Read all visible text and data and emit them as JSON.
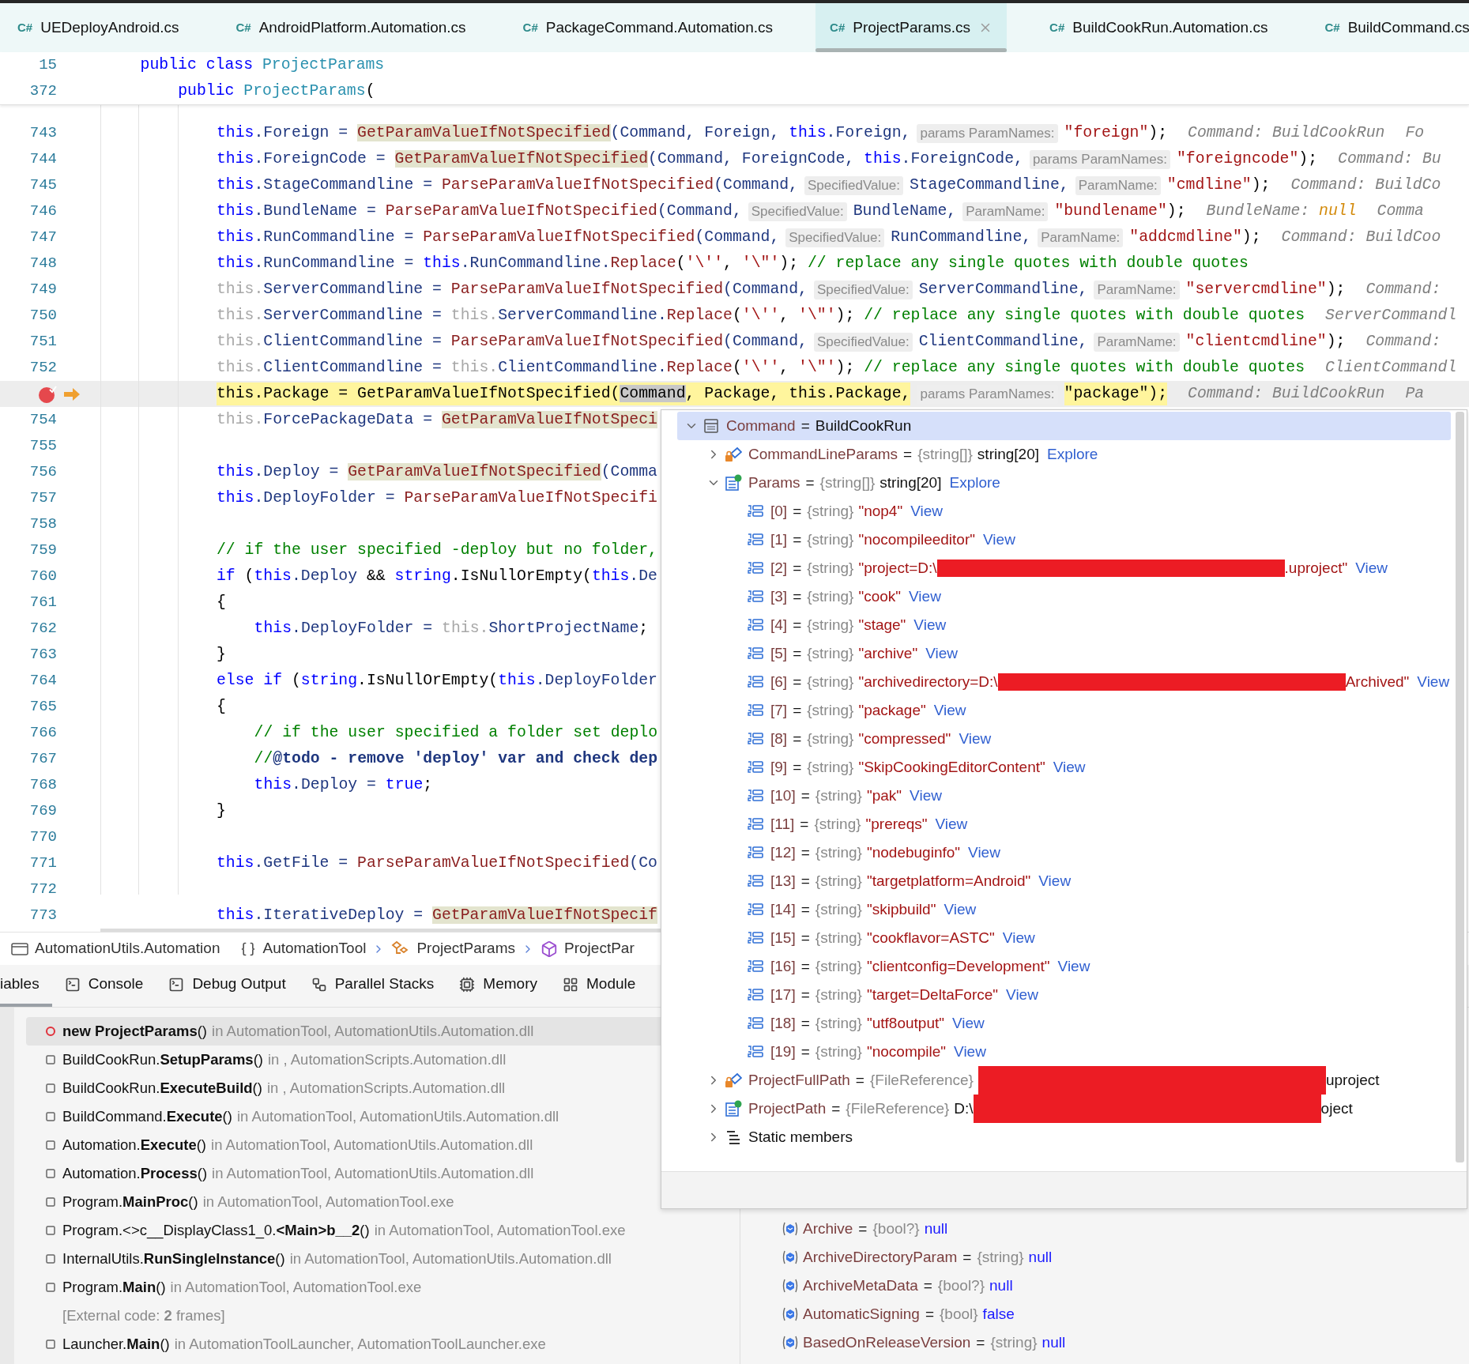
{
  "editor_tabs": [
    {
      "lang": "C#",
      "label": "UEDeployAndroid.cs",
      "selected": false
    },
    {
      "lang": "C#",
      "label": "AndroidPlatform.Automation.cs",
      "selected": false
    },
    {
      "lang": "C#",
      "label": "PackageCommand.Automation.cs",
      "selected": false
    },
    {
      "lang": "C#",
      "label": "ProjectParams.cs",
      "selected": true
    },
    {
      "lang": "C#",
      "label": "BuildCookRun.Automation.cs",
      "selected": false
    },
    {
      "lang": "C#",
      "label": "BuildCommand.cs",
      "selected": false
    }
  ],
  "sticky_header": [
    {
      "number": "15",
      "segments": [
        {
          "kind": "code",
          "tokens": [
            {
              "kind": "kw",
              "text": "public class "
            },
            {
              "kind": "type",
              "text": "ProjectParams"
            }
          ]
        }
      ],
      "children": [
        {
          "number": "372",
          "segments": [
            {
              "kind": "code",
              "tokens": [
                {
                  "kind": "kw",
                  "text": "public "
                },
                {
                  "kind": "type",
                  "text": "ProjectParams"
                },
                {
                  "kind": "p",
                  "text": "("
                }
              ]
            }
          ]
        }
      ]
    }
  ],
  "code": {
    "lines": [
      {
        "number": "743",
        "breakpoint": false,
        "current": false,
        "segments": [
          {
            "kind": "code",
            "tokens": [
              {
                "kind": "kw",
                "text": "this"
              },
              {
                "kind": "id",
                "text": ".Foreign = "
              },
              {
                "kind": "fnhl",
                "text": "GetParamValueIfNotSpecified"
              },
              {
                "kind": "id",
                "text": "(Command, Foreign, "
              },
              {
                "kind": "kw",
                "text": "this"
              },
              {
                "kind": "id",
                "text": ".Foreign,"
              }
            ]
          },
          {
            "kind": "hint",
            "text": "params ParamNames:"
          },
          {
            "kind": "code",
            "tokens": [
              {
                "kind": "str",
                "text": "\"foreign\""
              },
              {
                "kind": "p",
                "text": ");"
              }
            ]
          },
          {
            "kind": "debug",
            "tokens": [
              {
                "kind": "dbg",
                "text": "Command: BuildCookRun"
              }
            ]
          },
          {
            "kind": "debug",
            "tokens": [
              {
                "kind": "dbg",
                "text": "Fo"
              }
            ]
          }
        ]
      },
      {
        "number": "744",
        "breakpoint": false,
        "current": false,
        "segments": [
          {
            "kind": "code",
            "tokens": [
              {
                "kind": "kw",
                "text": "this"
              },
              {
                "kind": "id",
                "text": ".ForeignCode = "
              },
              {
                "kind": "fnhl",
                "text": "GetParamValueIfNotSpecified"
              },
              {
                "kind": "id",
                "text": "(Command, ForeignCode, "
              },
              {
                "kind": "kw",
                "text": "this"
              },
              {
                "kind": "id",
                "text": ".ForeignCode,"
              }
            ]
          },
          {
            "kind": "hint",
            "text": "params ParamNames:"
          },
          {
            "kind": "code",
            "tokens": [
              {
                "kind": "str",
                "text": "\"foreigncode\""
              },
              {
                "kind": "p",
                "text": ");"
              }
            ]
          },
          {
            "kind": "debug",
            "tokens": [
              {
                "kind": "dbg",
                "text": "Command: Bu"
              }
            ]
          }
        ]
      },
      {
        "number": "745",
        "breakpoint": false,
        "current": false,
        "segments": [
          {
            "kind": "code",
            "tokens": [
              {
                "kind": "kw",
                "text": "this"
              },
              {
                "kind": "id",
                "text": ".StageCommandline = "
              },
              {
                "kind": "fn",
                "text": "ParseParamValueIfNotSpecified"
              },
              {
                "kind": "id",
                "text": "(Command,"
              }
            ]
          },
          {
            "kind": "hint",
            "text": "SpecifiedValue:"
          },
          {
            "kind": "code",
            "tokens": [
              {
                "kind": "id",
                "text": "StageCommandline,"
              }
            ]
          },
          {
            "kind": "hint",
            "text": "ParamName:"
          },
          {
            "kind": "code",
            "tokens": [
              {
                "kind": "str",
                "text": "\"cmdline\""
              },
              {
                "kind": "p",
                "text": ");"
              }
            ]
          },
          {
            "kind": "debug",
            "tokens": [
              {
                "kind": "dbg",
                "text": "Command: BuildCo"
              }
            ]
          }
        ]
      },
      {
        "number": "746",
        "breakpoint": false,
        "current": false,
        "segments": [
          {
            "kind": "code",
            "tokens": [
              {
                "kind": "kw",
                "text": "this"
              },
              {
                "kind": "id",
                "text": ".BundleName = "
              },
              {
                "kind": "fn",
                "text": "ParseParamValueIfNotSpecified"
              },
              {
                "kind": "id",
                "text": "(Command,"
              }
            ]
          },
          {
            "kind": "hint",
            "text": "SpecifiedValue:"
          },
          {
            "kind": "code",
            "tokens": [
              {
                "kind": "id",
                "text": "BundleName,"
              }
            ]
          },
          {
            "kind": "hint",
            "text": "ParamName:"
          },
          {
            "kind": "code",
            "tokens": [
              {
                "kind": "str",
                "text": "\"bundlename\""
              },
              {
                "kind": "p",
                "text": ");"
              }
            ]
          },
          {
            "kind": "debug",
            "tokens": [
              {
                "kind": "dbg",
                "text": "BundleName: "
              },
              {
                "kind": "null",
                "text": "null"
              }
            ]
          },
          {
            "kind": "debug",
            "tokens": [
              {
                "kind": "dbg",
                "text": "Comma"
              }
            ]
          }
        ]
      },
      {
        "number": "747",
        "breakpoint": false,
        "current": false,
        "segments": [
          {
            "kind": "code",
            "tokens": [
              {
                "kind": "kw",
                "text": "this"
              },
              {
                "kind": "id",
                "text": ".RunCommandline = "
              },
              {
                "kind": "fn",
                "text": "ParseParamValueIfNotSpecified"
              },
              {
                "kind": "id",
                "text": "(Command,"
              }
            ]
          },
          {
            "kind": "hint",
            "text": "SpecifiedValue:"
          },
          {
            "kind": "code",
            "tokens": [
              {
                "kind": "id",
                "text": "RunCommandline,"
              }
            ]
          },
          {
            "kind": "hint",
            "text": "ParamName:"
          },
          {
            "kind": "code",
            "tokens": [
              {
                "kind": "str",
                "text": "\"addcmdline\""
              },
              {
                "kind": "p",
                "text": ");"
              }
            ]
          },
          {
            "kind": "debug",
            "tokens": [
              {
                "kind": "dbg",
                "text": "Command: BuildCoo"
              }
            ]
          }
        ]
      },
      {
        "number": "748",
        "breakpoint": false,
        "current": false,
        "segments": [
          {
            "kind": "code",
            "tokens": [
              {
                "kind": "kw",
                "text": "this"
              },
              {
                "kind": "id",
                "text": ".RunCommandline = "
              },
              {
                "kind": "kw",
                "text": "this"
              },
              {
                "kind": "id",
                "text": ".RunCommandline."
              },
              {
                "kind": "fn",
                "text": "Replace"
              },
              {
                "kind": "p",
                "text": "("
              },
              {
                "kind": "str",
                "text": "'\\''"
              },
              {
                "kind": "p",
                "text": ", "
              },
              {
                "kind": "str",
                "text": "'\\\"'"
              },
              {
                "kind": "p",
                "text": "); "
              },
              {
                "kind": "cmt",
                "text": "// replace any single quotes with double quotes"
              }
            ]
          }
        ]
      },
      {
        "number": "749",
        "breakpoint": false,
        "current": false,
        "segments": [
          {
            "kind": "code",
            "tokens": [
              {
                "kind": "dim",
                "text": "this."
              },
              {
                "kind": "id",
                "text": "ServerCommandline = "
              },
              {
                "kind": "fn",
                "text": "ParseParamValueIfNotSpecified"
              },
              {
                "kind": "id",
                "text": "(Command,"
              }
            ]
          },
          {
            "kind": "hint",
            "text": "SpecifiedValue:"
          },
          {
            "kind": "code",
            "tokens": [
              {
                "kind": "id",
                "text": "ServerCommandline,"
              }
            ]
          },
          {
            "kind": "hint",
            "text": "ParamName:"
          },
          {
            "kind": "code",
            "tokens": [
              {
                "kind": "str",
                "text": "\"servercmdline\""
              },
              {
                "kind": "p",
                "text": ");"
              }
            ]
          },
          {
            "kind": "debug",
            "tokens": [
              {
                "kind": "dbg",
                "text": "Command:"
              }
            ]
          }
        ]
      },
      {
        "number": "750",
        "breakpoint": false,
        "current": false,
        "segments": [
          {
            "kind": "code",
            "tokens": [
              {
                "kind": "dim",
                "text": "this."
              },
              {
                "kind": "id",
                "text": "ServerCommandline = "
              },
              {
                "kind": "dim",
                "text": "this."
              },
              {
                "kind": "id",
                "text": "ServerCommandline."
              },
              {
                "kind": "fn",
                "text": "Replace"
              },
              {
                "kind": "p",
                "text": "("
              },
              {
                "kind": "str",
                "text": "'\\''"
              },
              {
                "kind": "p",
                "text": ", "
              },
              {
                "kind": "str",
                "text": "'\\\"'"
              },
              {
                "kind": "p",
                "text": "); "
              },
              {
                "kind": "cmt",
                "text": "// replace any single quotes with double quotes"
              }
            ]
          },
          {
            "kind": "debug",
            "tokens": [
              {
                "kind": "dbg",
                "text": "ServerCommandl"
              }
            ]
          }
        ]
      },
      {
        "number": "751",
        "breakpoint": false,
        "current": false,
        "segments": [
          {
            "kind": "code",
            "tokens": [
              {
                "kind": "dim",
                "text": "this."
              },
              {
                "kind": "id",
                "text": "ClientCommandline = "
              },
              {
                "kind": "fn",
                "text": "ParseParamValueIfNotSpecified"
              },
              {
                "kind": "id",
                "text": "(Command,"
              }
            ]
          },
          {
            "kind": "hint",
            "text": "SpecifiedValue:"
          },
          {
            "kind": "code",
            "tokens": [
              {
                "kind": "id",
                "text": "ClientCommandline,"
              }
            ]
          },
          {
            "kind": "hint",
            "text": "ParamName:"
          },
          {
            "kind": "code",
            "tokens": [
              {
                "kind": "str",
                "text": "\"clientcmdline\""
              },
              {
                "kind": "p",
                "text": ");"
              }
            ]
          },
          {
            "kind": "debug",
            "tokens": [
              {
                "kind": "dbg",
                "text": "Command:"
              }
            ]
          }
        ]
      },
      {
        "number": "752",
        "breakpoint": false,
        "current": false,
        "segments": [
          {
            "kind": "code",
            "tokens": [
              {
                "kind": "dim",
                "text": "this."
              },
              {
                "kind": "id",
                "text": "ClientCommandline = "
              },
              {
                "kind": "dim",
                "text": "this."
              },
              {
                "kind": "id",
                "text": "ClientCommandline."
              },
              {
                "kind": "fn",
                "text": "Replace"
              },
              {
                "kind": "p",
                "text": "("
              },
              {
                "kind": "str",
                "text": "'\\''"
              },
              {
                "kind": "p",
                "text": ", "
              },
              {
                "kind": "str",
                "text": "'\\\"'"
              },
              {
                "kind": "p",
                "text": "); "
              },
              {
                "kind": "cmt",
                "text": "// replace any single quotes with double quotes"
              }
            ]
          },
          {
            "kind": "debug",
            "tokens": [
              {
                "kind": "dbg",
                "text": "ClientCommandl"
              }
            ]
          }
        ]
      },
      {
        "breakpoint": true,
        "current": true,
        "segments": [
          {
            "kind": "code",
            "tokens": [
              {
                "kind": "p",
                "text": "this.Package = GetParamValueIfNotSpecified("
              },
              {
                "kind": "sel",
                "text": "Command"
              },
              {
                "kind": "p",
                "text": ", Package, this.Package,"
              }
            ]
          },
          {
            "kind": "hint",
            "text": "params ParamNames:"
          },
          {
            "kind": "code",
            "tokens": [
              {
                "kind": "p",
                "text": "\"package\");"
              }
            ]
          },
          {
            "kind": "debug",
            "tokens": [
              {
                "kind": "dbg",
                "text": "Command: BuildCookRun"
              }
            ]
          },
          {
            "kind": "debug",
            "tokens": [
              {
                "kind": "dbg",
                "text": "Pa"
              }
            ]
          }
        ]
      },
      {
        "number": "754",
        "breakpoint": false,
        "current": false,
        "segments": [
          {
            "kind": "code",
            "tokens": [
              {
                "kind": "dim",
                "text": "this."
              },
              {
                "kind": "id",
                "text": "ForcePackageData = "
              },
              {
                "kind": "fnhl",
                "text": "GetParamValueIfNotSpeci"
              }
            ]
          }
        ]
      },
      {
        "number": "755",
        "breakpoint": false,
        "current": false
      },
      {
        "number": "756",
        "breakpoint": false,
        "current": false,
        "segments": [
          {
            "kind": "code",
            "tokens": [
              {
                "kind": "kw",
                "text": "this"
              },
              {
                "kind": "id",
                "text": ".Deploy = "
              },
              {
                "kind": "fnhl",
                "text": "GetParamValueIfNotSpecified"
              },
              {
                "kind": "id",
                "text": "(Comma"
              }
            ]
          }
        ]
      },
      {
        "number": "757",
        "breakpoint": false,
        "current": false,
        "segments": [
          {
            "kind": "code",
            "tokens": [
              {
                "kind": "kw",
                "text": "this"
              },
              {
                "kind": "id",
                "text": ".DeployFolder = "
              },
              {
                "kind": "fn",
                "text": "ParseParamValueIfNotSpecifi"
              }
            ]
          }
        ]
      },
      {
        "number": "758",
        "breakpoint": false,
        "current": false
      },
      {
        "number": "759",
        "breakpoint": false,
        "current": false,
        "segments": [
          {
            "kind": "code",
            "tokens": [
              {
                "kind": "cmt",
                "text": "// if the user specified -deploy but no folder,"
              }
            ]
          }
        ]
      },
      {
        "number": "760",
        "breakpoint": false,
        "current": false,
        "segments": [
          {
            "kind": "code",
            "tokens": [
              {
                "kind": "kw",
                "text": "if"
              },
              {
                "kind": "p",
                "text": " ("
              },
              {
                "kind": "kw",
                "text": "this"
              },
              {
                "kind": "id",
                "text": ".Deploy"
              },
              {
                "kind": "p",
                "text": " && "
              },
              {
                "kind": "kw",
                "text": "string"
              },
              {
                "kind": "p",
                "text": ".IsNullOrEmpty("
              },
              {
                "kind": "kw",
                "text": "this"
              },
              {
                "kind": "id",
                "text": ".De"
              }
            ]
          }
        ]
      },
      {
        "number": "761",
        "breakpoint": false,
        "current": false,
        "segments": [
          {
            "kind": "code",
            "tokens": [
              {
                "kind": "p",
                "text": "{"
              }
            ]
          }
        ],
        "children": [
          {
            "number": "762",
            "breakpoint": false,
            "current": false,
            "segments": [
              {
                "kind": "code",
                "tokens": [
                  {
                    "kind": "kw",
                    "text": "this"
                  },
                  {
                    "kind": "id",
                    "text": ".DeployFolder = "
                  },
                  {
                    "kind": "dim",
                    "text": "this."
                  },
                  {
                    "kind": "id",
                    "text": "ShortProjectName"
                  },
                  {
                    "kind": "p",
                    "text": ";"
                  }
                ]
              }
            ]
          }
        ]
      },
      {
        "number": "763",
        "breakpoint": false,
        "current": false,
        "segments": [
          {
            "kind": "code",
            "tokens": [
              {
                "kind": "p",
                "text": "}"
              }
            ]
          }
        ]
      },
      {
        "number": "764",
        "breakpoint": false,
        "current": false,
        "segments": [
          {
            "kind": "code",
            "tokens": [
              {
                "kind": "kw",
                "text": "else if"
              },
              {
                "kind": "p",
                "text": " ("
              },
              {
                "kind": "kw",
                "text": "string"
              },
              {
                "kind": "p",
                "text": ".IsNullOrEmpty("
              },
              {
                "kind": "kw",
                "text": "this"
              },
              {
                "kind": "id",
                "text": ".DeployFolder"
              }
            ]
          }
        ]
      },
      {
        "number": "765",
        "breakpoint": false,
        "current": false,
        "segments": [
          {
            "kind": "code",
            "tokens": [
              {
                "kind": "p",
                "text": "{"
              }
            ]
          }
        ],
        "children": [
          {
            "number": "766",
            "breakpoint": false,
            "current": false,
            "segments": [
              {
                "kind": "code",
                "tokens": [
                  {
                    "kind": "cmt",
                    "text": "// if the user specified a folder set deplo"
                  }
                ]
              }
            ]
          },
          {
            "number": "767",
            "breakpoint": false,
            "current": false,
            "segments": [
              {
                "kind": "code",
                "tokens": [
                  {
                    "kind": "cmt",
                    "text": "//"
                  },
                  {
                    "kind": "todo",
                    "text": "@todo - remove 'deploy' var and check dep"
                  }
                ]
              }
            ]
          },
          {
            "number": "768",
            "breakpoint": false,
            "current": false,
            "segments": [
              {
                "kind": "code",
                "tokens": [
                  {
                    "kind": "kw",
                    "text": "this"
                  },
                  {
                    "kind": "id",
                    "text": ".Deploy = "
                  },
                  {
                    "kind": "kw",
                    "text": "true"
                  },
                  {
                    "kind": "p",
                    "text": ";"
                  }
                ]
              }
            ]
          }
        ]
      },
      {
        "number": "769",
        "breakpoint": false,
        "current": false,
        "segments": [
          {
            "kind": "code",
            "tokens": [
              {
                "kind": "p",
                "text": "}"
              }
            ]
          }
        ]
      },
      {
        "number": "770",
        "breakpoint": false,
        "current": false
      },
      {
        "number": "771",
        "breakpoint": false,
        "current": false,
        "segments": [
          {
            "kind": "code",
            "tokens": [
              {
                "kind": "kw",
                "text": "this"
              },
              {
                "kind": "id",
                "text": ".GetFile = "
              },
              {
                "kind": "fn",
                "text": "ParseParamValueIfNotSpecified"
              },
              {
                "kind": "id",
                "text": "(Co"
              }
            ]
          }
        ]
      },
      {
        "number": "772",
        "breakpoint": false,
        "current": false
      },
      {
        "number": "773",
        "breakpoint": false,
        "current": false,
        "segments": [
          {
            "kind": "code",
            "tokens": [
              {
                "kind": "kw",
                "text": "this"
              },
              {
                "kind": "id",
                "text": ".IterativeDeploy = "
              },
              {
                "kind": "fnhl",
                "text": "GetParamValueIfNotSpecif"
              }
            ]
          }
        ]
      }
    ]
  },
  "breadcrumb": [
    {
      "kind": "project",
      "label": "AutomationUtils.Automation"
    },
    {
      "kind": "namespace",
      "label": "AutomationTool"
    },
    {
      "kind": "class",
      "label": "ProjectParams"
    },
    {
      "kind": "method",
      "label": "ProjectPar"
    }
  ],
  "tool_tabs": [
    {
      "kind": "variables",
      "label": "iables",
      "selected": true
    },
    {
      "kind": "console",
      "label": "Console",
      "selected": false
    },
    {
      "kind": "output",
      "label": "Debug Output",
      "selected": false
    },
    {
      "kind": "stacks",
      "label": "Parallel Stacks",
      "selected": false
    },
    {
      "kind": "memory",
      "label": "Memory",
      "selected": false
    },
    {
      "kind": "modules",
      "label": "Module",
      "selected": false
    }
  ],
  "call_stack": [
    {
      "kind": "frame",
      "current": true,
      "method": "**new ProjectParams**()",
      "location": "in AutomationTool, AutomationUtils.Automation.dll"
    },
    {
      "kind": "frame",
      "current": false,
      "method": "BuildCookRun.**SetupParams**()",
      "location": "in , AutomationScripts.Automation.dll"
    },
    {
      "kind": "frame",
      "current": false,
      "method": "BuildCookRun.**ExecuteBuild**()",
      "location": "in , AutomationScripts.Automation.dll"
    },
    {
      "kind": "frame",
      "current": false,
      "method": "BuildCommand.**Execute**()",
      "location": "in AutomationTool, AutomationUtils.Automation.dll"
    },
    {
      "kind": "frame",
      "current": false,
      "method": "Automation.**Execute**()",
      "location": "in AutomationTool, AutomationUtils.Automation.dll"
    },
    {
      "kind": "frame",
      "current": false,
      "method": "Automation.**Process**()",
      "location": "in AutomationTool, AutomationUtils.Automation.dll"
    },
    {
      "kind": "frame",
      "current": false,
      "method": "Program.**MainProc**()",
      "location": "in AutomationTool, AutomationTool.exe"
    },
    {
      "kind": "frame",
      "current": false,
      "method": "Program.<>c__DisplayClass1_0.**<Main>b__2**()",
      "location": "in AutomationTool, AutomationTool.exe"
    },
    {
      "kind": "frame",
      "current": false,
      "method": "InternalUtils.**RunSingleInstance**()",
      "location": "in AutomationTool, AutomationUtils.Automation.dll"
    },
    {
      "kind": "frame",
      "current": false,
      "method": "Program.**Main**()",
      "location": "in AutomationTool, AutomationTool.exe"
    },
    {
      "kind": "external",
      "text": "[External code: **2** frames]"
    },
    {
      "kind": "frame",
      "current": false,
      "method": "Launcher.**Main**()",
      "location": "in AutomationToolLauncher, AutomationToolLauncher.exe"
    }
  ],
  "locals": [
    {
      "name": "Archive",
      "op": "=",
      "type": "{bool?}",
      "value": "null"
    },
    {
      "name": "ArchiveDirectoryParam",
      "op": "=",
      "type": "{string}",
      "value": "null"
    },
    {
      "name": "ArchiveMetaData",
      "op": "=",
      "type": "{bool?}",
      "value": "null"
    },
    {
      "name": "AutomaticSigning",
      "op": "=",
      "type": "{bool}",
      "value": "false"
    },
    {
      "name": "BasedOnReleaseVersion",
      "op": "=",
      "type": "{string}",
      "value": "null"
    }
  ],
  "debug_popup": {
    "tree": [
      {
        "kind": "object",
        "name": "Command",
        "op": "=",
        "value": "BuildCookRun",
        "expanded": true,
        "selected": true,
        "redacted": false,
        "children": [
          {
            "kind": "locked_property",
            "name": "CommandLineParams",
            "op": "=",
            "type": "{string[]}",
            "value": "string[20]",
            "link": "Explore",
            "expanded": false,
            "selected": false,
            "redacted": false
          },
          {
            "kind": "list_property",
            "name": "Params",
            "op": "=",
            "type": "{string[]}",
            "value": "string[20]",
            "link": "Explore",
            "expanded": true,
            "selected": false,
            "redacted": false,
            "children": [
              {
                "kind": "element",
                "name": "[0]",
                "op": "=",
                "type": "{string}",
                "value": "\"nop4\"",
                "link": "View",
                "selected": false,
                "redacted": false
              },
              {
                "kind": "element",
                "name": "[1]",
                "op": "=",
                "type": "{string}",
                "value": "\"nocompileeditor\"",
                "link": "View",
                "selected": false,
                "redacted": false
              },
              {
                "kind": "element",
                "name": "[2]",
                "op": "=",
                "type": "{string}",
                "value": "\"project=D:\\",
                "value_end": ".uproject\"",
                "link": "View",
                "selected": false,
                "redacted": true
              },
              {
                "kind": "element",
                "name": "[3]",
                "op": "=",
                "type": "{string}",
                "value": "\"cook\"",
                "link": "View",
                "selected": false,
                "redacted": false
              },
              {
                "kind": "element",
                "name": "[4]",
                "op": "=",
                "type": "{string}",
                "value": "\"stage\"",
                "link": "View",
                "selected": false,
                "redacted": false
              },
              {
                "kind": "element",
                "name": "[5]",
                "op": "=",
                "type": "{string}",
                "value": "\"archive\"",
                "link": "View",
                "selected": false,
                "redacted": false
              },
              {
                "kind": "element",
                "name": "[6]",
                "op": "=",
                "type": "{string}",
                "value": "\"archivedirectory=D:\\",
                "value_end": "Archived\"",
                "link": "View",
                "selected": false,
                "redacted": true
              },
              {
                "kind": "element",
                "name": "[7]",
                "op": "=",
                "type": "{string}",
                "value": "\"package\"",
                "link": "View",
                "selected": false,
                "redacted": false
              },
              {
                "kind": "element",
                "name": "[8]",
                "op": "=",
                "type": "{string}",
                "value": "\"compressed\"",
                "link": "View",
                "selected": false,
                "redacted": false
              },
              {
                "kind": "element",
                "name": "[9]",
                "op": "=",
                "type": "{string}",
                "value": "\"SkipCookingEditorContent\"",
                "link": "View",
                "selected": false,
                "redacted": false
              },
              {
                "kind": "element",
                "name": "[10]",
                "op": "=",
                "type": "{string}",
                "value": "\"pak\"",
                "link": "View",
                "selected": false,
                "redacted": false
              },
              {
                "kind": "element",
                "name": "[11]",
                "op": "=",
                "type": "{string}",
                "value": "\"prereqs\"",
                "link": "View",
                "selected": false,
                "redacted": false
              },
              {
                "kind": "element",
                "name": "[12]",
                "op": "=",
                "type": "{string}",
                "value": "\"nodebuginfo\"",
                "link": "View",
                "selected": false,
                "redacted": false
              },
              {
                "kind": "element",
                "name": "[13]",
                "op": "=",
                "type": "{string}",
                "value": "\"targetplatform=Android\"",
                "link": "View",
                "selected": false,
                "redacted": false
              },
              {
                "kind": "element",
                "name": "[14]",
                "op": "=",
                "type": "{string}",
                "value": "\"skipbuild\"",
                "link": "View",
                "selected": false,
                "redacted": false
              },
              {
                "kind": "element",
                "name": "[15]",
                "op": "=",
                "type": "{string}",
                "value": "\"cookflavor=ASTC\"",
                "link": "View",
                "selected": false,
                "redacted": false
              },
              {
                "kind": "element",
                "name": "[16]",
                "op": "=",
                "type": "{string}",
                "value": "\"clientconfig=Development\"",
                "link": "View",
                "selected": false,
                "redacted": false
              },
              {
                "kind": "element",
                "name": "[17]",
                "op": "=",
                "type": "{string}",
                "value": "\"target=DeltaForce\"",
                "link": "View",
                "selected": false,
                "redacted": false
              },
              {
                "kind": "element",
                "name": "[18]",
                "op": "=",
                "type": "{string}",
                "value": "\"utf8output\"",
                "link": "View",
                "selected": false,
                "redacted": false
              },
              {
                "kind": "element",
                "name": "[19]",
                "op": "=",
                "type": "{string}",
                "value": "\"nocompile\"",
                "link": "View",
                "selected": false,
                "redacted": false
              }
            ]
          },
          {
            "kind": "locked_property",
            "name": "ProjectFullPath",
            "op": "=",
            "type": "{FileReference}",
            "value_end": "uproject",
            "expanded": false,
            "selected": false,
            "redacted": true
          },
          {
            "kind": "list_property",
            "name": "ProjectPath",
            "op": "=",
            "type": "{FileReference}",
            "value": "D:\\",
            "value_end": "oject",
            "expanded": false,
            "selected": false,
            "redacted": true
          },
          {
            "kind": "static",
            "name": "Static members",
            "expanded": false,
            "selected": false,
            "redacted": false
          }
        ]
      }
    ]
  }
}
